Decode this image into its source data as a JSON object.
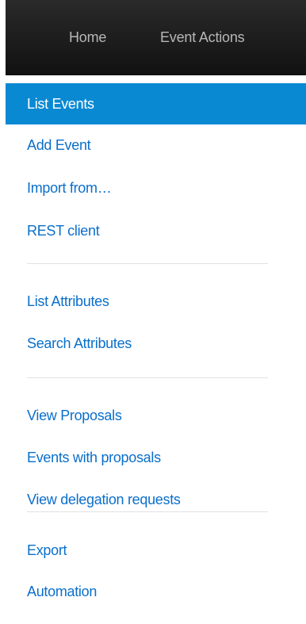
{
  "navbar": {
    "home_label": "Home",
    "event_actions_label": "Event Actions"
  },
  "menu": {
    "active_item": "List Events",
    "groups": [
      {
        "items": [
          "List Events",
          "Add Event",
          "Import from…",
          "REST client"
        ]
      },
      {
        "items": [
          "List Attributes",
          "Search Attributes"
        ]
      },
      {
        "items": [
          "View Proposals",
          "Events with proposals",
          "View delegation requests"
        ]
      },
      {
        "items": [
          "Export",
          "Automation"
        ]
      }
    ]
  },
  "colors": {
    "navbar_bg": "#1c1c1c",
    "navbar_text": "#b7b7b7",
    "active_bg": "#0a89d3",
    "link": "#0a6fcb",
    "divider": "#e1e1e1"
  }
}
